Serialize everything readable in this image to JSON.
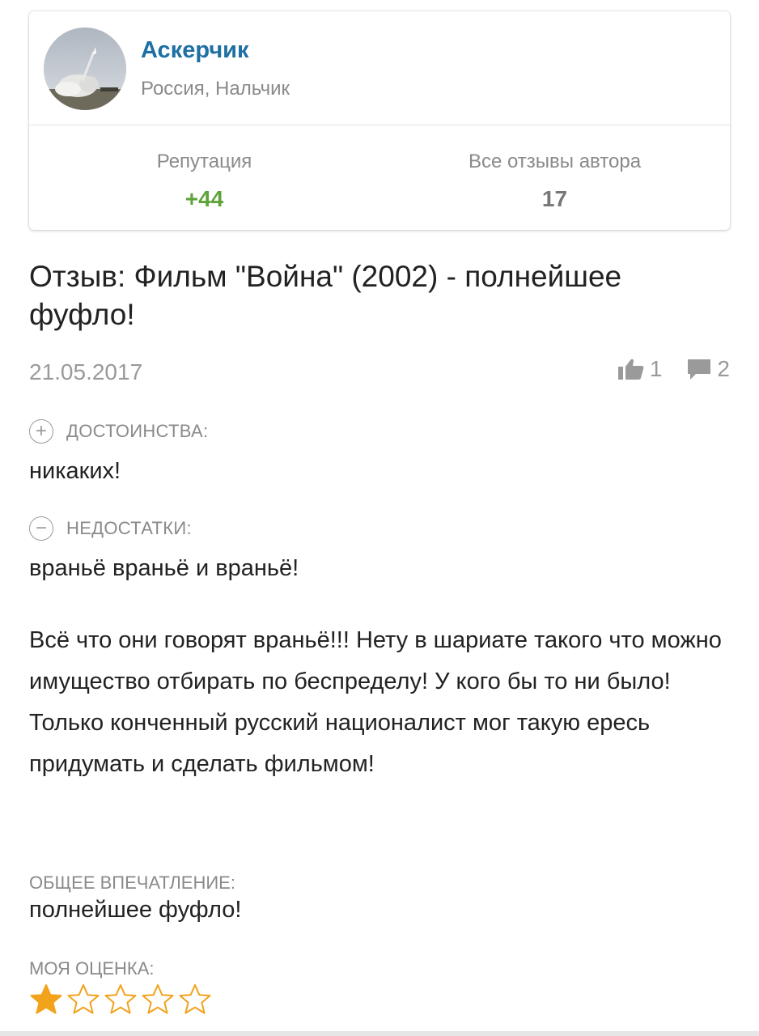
{
  "author": {
    "name": "Аскерчик",
    "location": "Россия, Нальчик"
  },
  "stats": {
    "reputation_label": "Репутация",
    "reputation_value": "+44",
    "reviews_label": "Все отзывы автора",
    "reviews_value": "17"
  },
  "review": {
    "title": "Отзыв: Фильм \"Война\" (2002) - полнейшее фуфло!",
    "date": "21.05.2017",
    "likes": "1",
    "comments": "2",
    "pros_label": "ДОСТОИНСТВА:",
    "pros_text": "никаких!",
    "cons_label": "НЕДОСТАТКИ:",
    "cons_text": "враньё враньё и враньё!",
    "body_paragraphs": [
      "Всё что они говорят враньё!!! Нету в шариате такого что можно имущество отбирать по беспределу! У кого бы то ни было!",
      "Только конченный русский националист мог такую ересь придумать и сделать фильмом!"
    ],
    "impression_label": "ОБЩЕЕ ВПЕЧАТЛЕНИЕ:",
    "impression_text": "полнейшее фуфло!",
    "rating_label": "МОЯ ОЦЕНКА:",
    "rating": 1,
    "rating_max": 5
  },
  "colors": {
    "author_link": "#1e6fa3",
    "reputation": "#5ea33a",
    "star_filled": "#f2a21b",
    "star_empty_stroke": "#f2a21b"
  },
  "icons": {
    "likes": "thumbs-up-icon",
    "comments": "comment-icon",
    "pros": "plus-circle-icon",
    "cons": "minus-circle-icon",
    "star": "star-icon"
  }
}
